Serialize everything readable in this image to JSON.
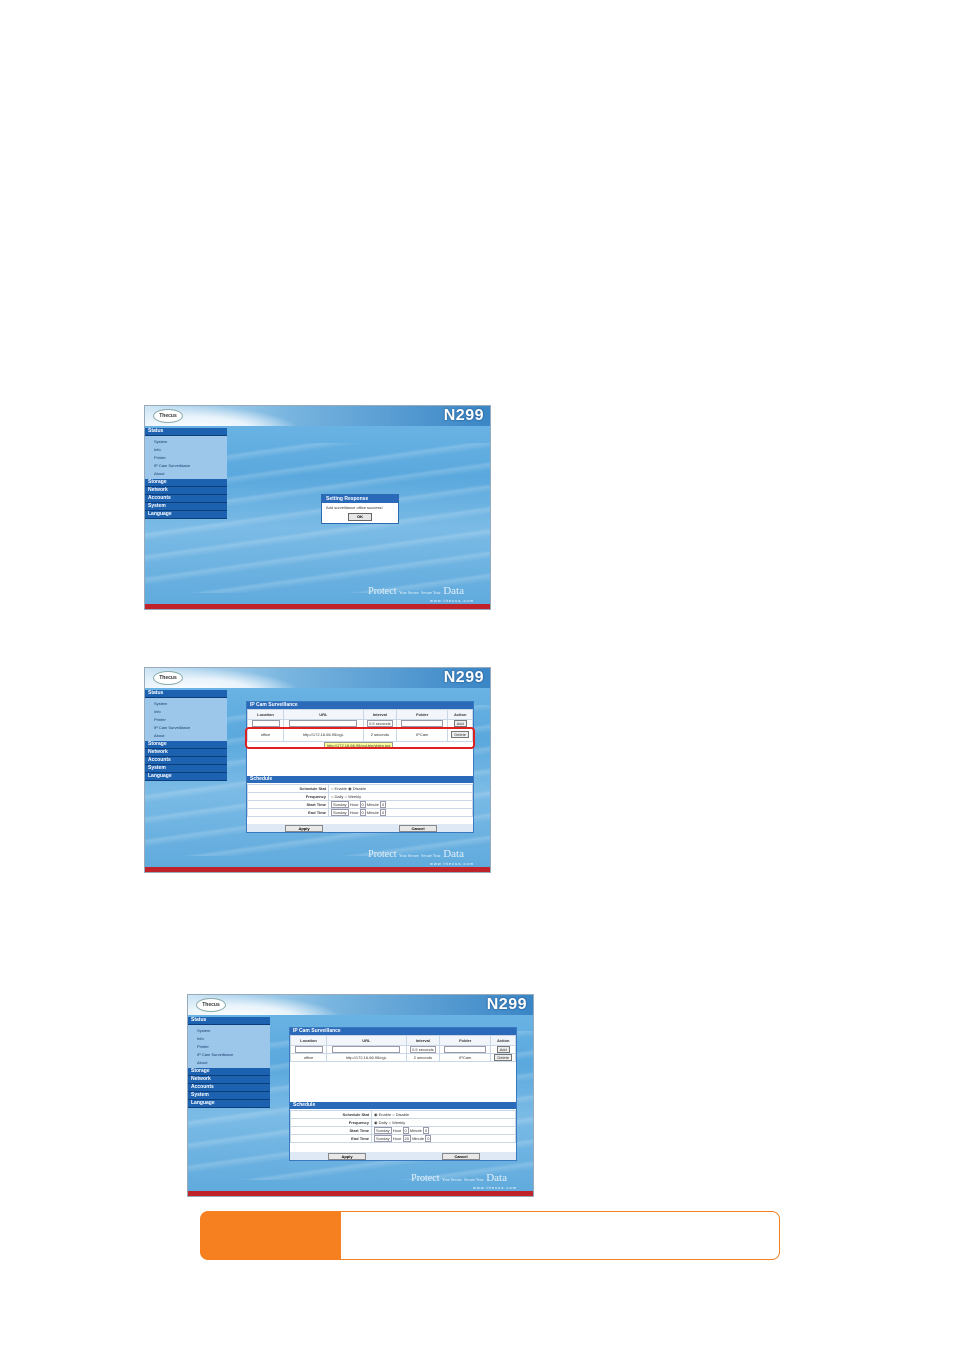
{
  "screens": [
    {
      "model": "N299",
      "logo": "Thecus",
      "menu": {
        "status": "Status",
        "status_items": [
          "System",
          "Info",
          "Printer",
          "IP Cam Surveillance",
          "About"
        ],
        "sections": [
          "Storage",
          "Network",
          "Accounts",
          "System",
          "Language"
        ]
      },
      "dialog": {
        "title": "Setting Response",
        "message": "Add surveillance office success!",
        "ok": "OK"
      },
      "footer_url": "www.thecus.com",
      "tagline": {
        "protect": "Protect",
        "your": "Your Secure",
        "secure": "Secure Your",
        "data": "Data"
      }
    },
    {
      "model": "N299",
      "logo": "Thecus",
      "menu": {
        "status": "Status",
        "status_items": [
          "System",
          "Info",
          "Printer",
          "IP Cam Surveillance",
          "About"
        ],
        "sections": [
          "Storage",
          "Network",
          "Accounts",
          "System",
          "Language"
        ]
      },
      "panel": {
        "title": "IP Cam Surveillance",
        "headers": [
          "Location",
          "URL",
          "Interval",
          "Folder",
          "Action"
        ],
        "interval_default": "0.5 seconds",
        "add": "Add",
        "row": {
          "location": "office",
          "url": "http://172.16.66.95/cgi-",
          "interval": "2 seconds",
          "folder": "IPCam",
          "action": "Delete"
        },
        "tooltip": "http://172.16.66.95/cgi-bin/video.jpg"
      },
      "schedule": {
        "title": "Schedule",
        "labels": [
          "Schedule Stat",
          "Frequency",
          "Start Time",
          "End Time"
        ],
        "stat_options": [
          "Enable",
          "Disable"
        ],
        "freq_options": [
          "Daily",
          "Weekly"
        ],
        "day": "Sunday",
        "hour": "Hour",
        "minute": "Minute",
        "start_hour": "0",
        "start_min": "0",
        "end_hour": "0",
        "end_min": "0"
      },
      "apply": "Apply",
      "cancel": "Cancel",
      "footer_url": "www.thecus.com",
      "tagline": {
        "protect": "Protect",
        "your": "Your Secure",
        "secure": "Secure Your",
        "data": "Data"
      }
    },
    {
      "model": "N299",
      "logo": "Thecus",
      "menu": {
        "status": "Status",
        "status_items": [
          "System",
          "Info",
          "Printer",
          "IP Cam Surveillance",
          "About"
        ],
        "sections": [
          "Storage",
          "Network",
          "Accounts",
          "System",
          "Language"
        ]
      },
      "panel": {
        "title": "IP Cam Surveillance",
        "headers": [
          "Location",
          "URL",
          "Interval",
          "Folder",
          "Action"
        ],
        "interval_default": "0.5 seconds",
        "add": "Add",
        "row": {
          "location": "office",
          "url": "http://172.16.66.95/cgi-",
          "interval": "2 seconds",
          "folder": "IPCam",
          "action": "Delete"
        }
      },
      "schedule": {
        "title": "Schedule",
        "labels": [
          "Schedule Stat",
          "Frequency",
          "Start Time",
          "End Time"
        ],
        "stat_options": [
          "Enable",
          "Disable"
        ],
        "freq_options": [
          "Daily",
          "Weekly"
        ],
        "day": "Sunday",
        "hour": "Hour",
        "minute": "Minute",
        "start_hour": "0",
        "start_min": "0",
        "end_hour": "20",
        "end_min": "0"
      },
      "apply": "Apply",
      "cancel": "Cancel",
      "footer_url": "www.thecus.com",
      "tagline": {
        "protect": "Protect",
        "your": "Your Secure",
        "secure": "Secure Your",
        "data": "Data"
      }
    }
  ],
  "colors": {
    "accent": "#f6801f",
    "header_blue": "#2a6ab8",
    "footer_red": "#c0222a"
  }
}
